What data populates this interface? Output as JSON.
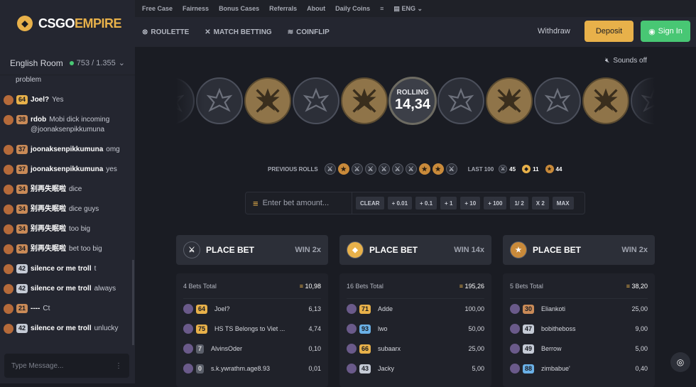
{
  "brand": {
    "name_a": "CSGO",
    "name_b": "EMPIRE"
  },
  "sidebar": {
    "room": "English Room",
    "online": "753 / 1.355",
    "messages": [
      {
        "level": "",
        "badge": "",
        "user": "",
        "text": "problem"
      },
      {
        "level": "64",
        "badge": "gold",
        "user": "Joel?",
        "text": "Yes"
      },
      {
        "level": "38",
        "badge": "bronze",
        "user": "rdob",
        "text": "Mobi dick incoming @joonaksenpikkumuna"
      },
      {
        "level": "37",
        "badge": "bronze",
        "user": "joonaksenpikkumuna",
        "text": "omg"
      },
      {
        "level": "37",
        "badge": "bronze",
        "user": "joonaksenpikkumuna",
        "text": "yes"
      },
      {
        "level": "34",
        "badge": "bronze",
        "user": "别再失眠啦",
        "text": "dice"
      },
      {
        "level": "34",
        "badge": "bronze",
        "user": "别再失眠啦",
        "text": "dice guys"
      },
      {
        "level": "34",
        "badge": "bronze",
        "user": "别再失眠啦",
        "text": "too big"
      },
      {
        "level": "34",
        "badge": "bronze",
        "user": "别再失眠啦",
        "text": "bet too big"
      },
      {
        "level": "42",
        "badge": "silver",
        "user": "silence or me troll",
        "text": "t"
      },
      {
        "level": "42",
        "badge": "silver",
        "user": "silence or me troll",
        "text": "always"
      },
      {
        "level": "21",
        "badge": "bronze",
        "user": "----",
        "text": "Ct"
      },
      {
        "level": "42",
        "badge": "silver",
        "user": "silence or me troll",
        "text": "unlucky"
      }
    ],
    "input_placeholder": "Type Message..."
  },
  "topnav": {
    "items": [
      "Free Case",
      "Fairness",
      "Bonus Cases",
      "Referrals",
      "About",
      "Daily Coins"
    ],
    "lang": "ENG"
  },
  "subnav": {
    "items": [
      "ROULETTE",
      "MATCH BETTING",
      "COINFLIP"
    ],
    "withdraw": "Withdraw",
    "deposit": "Deposit",
    "signin": "Sign In"
  },
  "sounds": "Sounds off",
  "roll": {
    "label": "ROLLING",
    "value": "14,34"
  },
  "previous": {
    "label": "PREVIOUS ROLLS",
    "last_label": "LAST 100",
    "ct": "45",
    "bonus": "11",
    "t": "44"
  },
  "bet": {
    "placeholder": "Enter bet amount...",
    "buttons": [
      "CLEAR",
      "+ 0.01",
      "+ 0.1",
      "+ 1",
      "+ 10",
      "+ 100",
      "1/ 2",
      "X 2",
      "MAX"
    ]
  },
  "columns": [
    {
      "title": "PLACE BET",
      "win": "WIN 2x",
      "total_label": "4 Bets Total",
      "total": "10,98",
      "rows": [
        {
          "level": "64",
          "badge": "gold",
          "name": "Joel?",
          "amount": "6,13"
        },
        {
          "level": "75",
          "badge": "gold",
          "name": "HS TS Belongs to Viet ...",
          "amount": "4,74"
        },
        {
          "level": "7",
          "badge": "gray",
          "name": "AlvinsOder",
          "amount": "0,10"
        },
        {
          "level": "0",
          "badge": "gray",
          "name": "s.k.ywrathm.age8.93",
          "amount": "0,01"
        }
      ]
    },
    {
      "title": "PLACE BET",
      "win": "WIN 14x",
      "total_label": "16 Bets Total",
      "total": "195,26",
      "rows": [
        {
          "level": "71",
          "badge": "gold",
          "name": "Adde",
          "amount": "100,00"
        },
        {
          "level": "93",
          "badge": "blue",
          "name": "lwo",
          "amount": "50,00"
        },
        {
          "level": "66",
          "badge": "gold",
          "name": "subaarx",
          "amount": "25,00"
        },
        {
          "level": "43",
          "badge": "silver",
          "name": "Jacky",
          "amount": "5,00"
        }
      ]
    },
    {
      "title": "PLACE BET",
      "win": "WIN 2x",
      "total_label": "5 Bets Total",
      "total": "38,20",
      "rows": [
        {
          "level": "30",
          "badge": "bronze",
          "name": "Eliankoti",
          "amount": "25,00"
        },
        {
          "level": "47",
          "badge": "silver",
          "name": "bobitheboss",
          "amount": "9,00"
        },
        {
          "level": "49",
          "badge": "silver",
          "name": "Berrow",
          "amount": "5,00"
        },
        {
          "level": "88",
          "badge": "blue",
          "name": "zimbabue'",
          "amount": "0,40"
        }
      ]
    }
  ],
  "colors": {
    "gold": "#e8b14a",
    "green": "#48c774",
    "bg": "#1a1c23"
  }
}
